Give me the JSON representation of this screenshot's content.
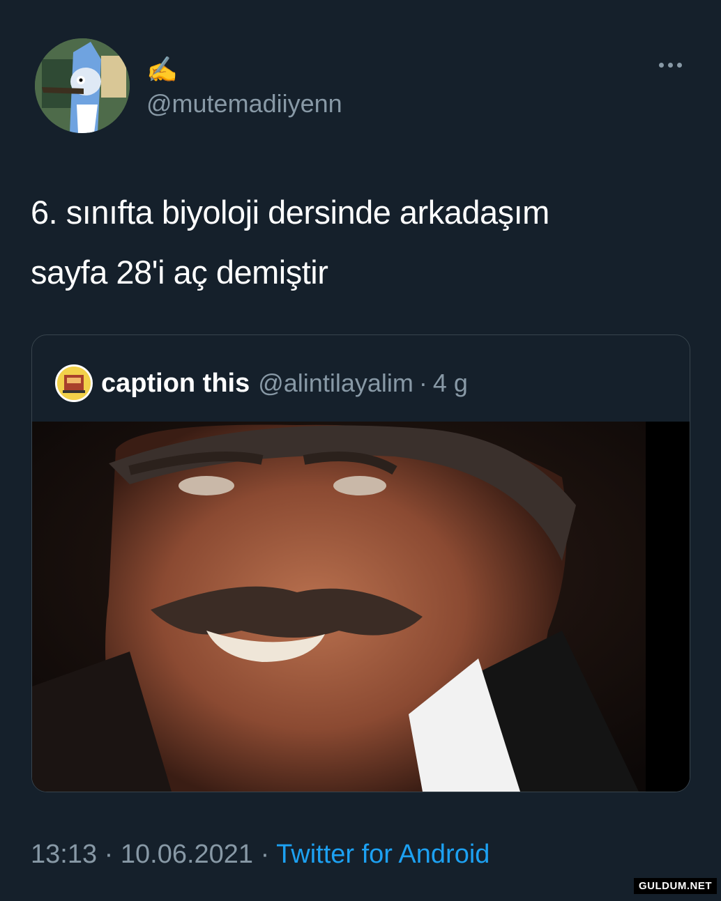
{
  "tweet": {
    "display_name": "✍️",
    "handle": "@mutemadiiyenn",
    "more_icon": "more-dots-icon",
    "text_line1": "6. sınıfta biyoloji dersinde arkadaşım",
    "text_line2": "sayfa 28'i aç demiştir",
    "time": "13:13",
    "separator": "·",
    "date": "10.06.2021",
    "source": "Twitter for Android"
  },
  "quoted": {
    "name": "caption this",
    "handle": "@alintilayalim",
    "separator": "·",
    "age": "4 g"
  },
  "watermark": "GULDUM.NET",
  "colors": {
    "background": "#15202b",
    "secondary_text": "#8899a6",
    "link": "#1da1f2",
    "border": "#38444d"
  }
}
